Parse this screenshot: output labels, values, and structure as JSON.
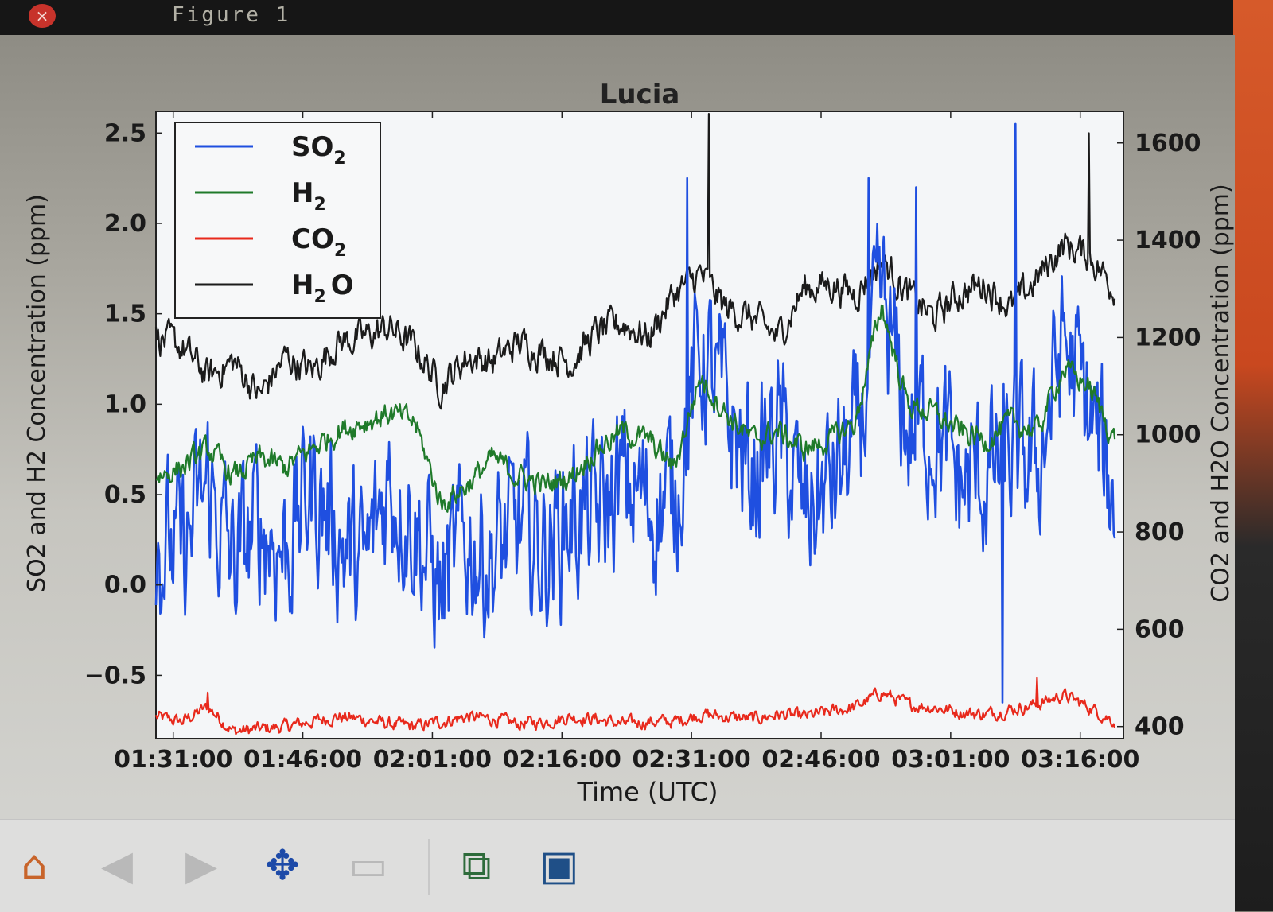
{
  "window": {
    "title": "Figure 1",
    "close_symbol": "×"
  },
  "toolbar": {
    "buttons": [
      {
        "name": "home",
        "icon": "home-icon",
        "glyph": "⌂",
        "enabled": true
      },
      {
        "name": "back",
        "icon": "back-arrow-icon",
        "glyph": "◀",
        "enabled": false
      },
      {
        "name": "forward",
        "icon": "forward-arrow-icon",
        "glyph": "▶",
        "enabled": false
      },
      {
        "name": "pan",
        "icon": "pan-move-icon",
        "glyph": "✥",
        "enabled": true
      },
      {
        "name": "zoom",
        "icon": "zoom-rect-icon",
        "glyph": "▭",
        "enabled": false
      },
      {
        "name": "subplots",
        "icon": "subplots-config-icon",
        "glyph": "⧉",
        "enabled": true
      },
      {
        "name": "save",
        "icon": "save-floppy-icon",
        "glyph": "▣",
        "enabled": true
      }
    ]
  },
  "chart_data": {
    "type": "line",
    "title": "Lucia",
    "xlabel": "Time (UTC)",
    "ylabel_left": "SO2 and H2 Concentration (ppm)",
    "ylabel_right": "CO2 and H2O Concentration (ppm)",
    "x_ticks": [
      "01:31:00",
      "01:46:00",
      "02:01:00",
      "02:16:00",
      "02:31:00",
      "02:46:00",
      "03:01:00",
      "03:16:00"
    ],
    "x_range": [
      "01:29:00",
      "03:21:00"
    ],
    "ylim_left": [
      -0.85,
      2.62
    ],
    "ylim_right": [
      375,
      1665
    ],
    "yticks_left": [
      -0.5,
      0.0,
      0.5,
      1.0,
      1.5,
      2.0,
      2.5
    ],
    "yticks_left_labels": [
      "−0.5",
      "0.0",
      "0.5",
      "1.0",
      "1.5",
      "2.0",
      "2.5"
    ],
    "yticks_right": [
      400,
      600,
      800,
      1000,
      1200,
      1400,
      1600
    ],
    "grid": false,
    "legend_position": "upper-left",
    "series": [
      {
        "name": "SO2",
        "legend_main": "SO",
        "legend_sub": "2",
        "color": "#1f4fe0",
        "axis": "left",
        "times": [
          "01:29",
          "01:32",
          "01:35",
          "01:38",
          "01:41",
          "01:44",
          "01:47",
          "01:50",
          "01:53",
          "01:56",
          "01:59",
          "02:02",
          "02:05",
          "02:08",
          "02:11",
          "02:14",
          "02:17",
          "02:20",
          "02:23",
          "02:26",
          "02:29",
          "02:32",
          "02:35",
          "02:38",
          "02:41",
          "02:44",
          "02:47",
          "02:50",
          "02:53",
          "02:56",
          "02:59",
          "03:02",
          "03:05",
          "03:08",
          "03:11",
          "03:14",
          "03:17",
          "03:20"
        ],
        "values": [
          0.25,
          0.15,
          0.55,
          0.1,
          0.35,
          0.2,
          0.55,
          0.3,
          0.05,
          0.6,
          0.35,
          -0.05,
          0.25,
          0.15,
          0.3,
          0.2,
          0.4,
          0.35,
          0.55,
          0.45,
          0.5,
          1.3,
          0.95,
          0.6,
          0.85,
          0.4,
          0.55,
          0.75,
          1.55,
          0.85,
          0.9,
          0.55,
          0.6,
          0.7,
          0.65,
          1.35,
          0.95,
          0.45
        ]
      },
      {
        "name": "H2",
        "legend_main": "H",
        "legend_sub": "2",
        "color": "#1f7a2a",
        "axis": "left",
        "times": [
          "01:29",
          "01:32",
          "01:35",
          "01:38",
          "01:41",
          "01:44",
          "01:47",
          "01:50",
          "01:53",
          "01:56",
          "01:59",
          "02:02",
          "02:05",
          "02:08",
          "02:11",
          "02:14",
          "02:17",
          "02:20",
          "02:23",
          "02:26",
          "02:29",
          "02:32",
          "02:35",
          "02:38",
          "02:41",
          "02:44",
          "02:47",
          "02:50",
          "02:53",
          "02:56",
          "02:59",
          "03:02",
          "03:05",
          "03:08",
          "03:11",
          "03:14",
          "03:17",
          "03:20"
        ],
        "values": [
          0.6,
          0.65,
          0.75,
          0.6,
          0.7,
          0.65,
          0.75,
          0.85,
          0.9,
          0.95,
          0.9,
          0.45,
          0.55,
          0.7,
          0.6,
          0.55,
          0.6,
          0.75,
          0.85,
          0.8,
          0.65,
          1.15,
          0.95,
          0.8,
          0.85,
          0.75,
          0.8,
          0.9,
          1.55,
          1.0,
          0.95,
          0.85,
          0.8,
          0.9,
          0.85,
          1.2,
          1.1,
          0.8
        ]
      },
      {
        "name": "CO2",
        "legend_main": "CO",
        "legend_sub": "2",
        "color": "#e8291c",
        "axis": "right",
        "times": [
          "01:29",
          "01:32",
          "01:35",
          "01:38",
          "01:41",
          "01:44",
          "01:47",
          "01:50",
          "01:53",
          "01:56",
          "01:59",
          "02:02",
          "02:05",
          "02:08",
          "02:11",
          "02:14",
          "02:17",
          "02:20",
          "02:23",
          "02:26",
          "02:29",
          "02:32",
          "02:35",
          "02:38",
          "02:41",
          "02:44",
          "02:47",
          "02:50",
          "02:53",
          "02:56",
          "02:59",
          "03:02",
          "03:05",
          "03:08",
          "03:11",
          "03:14",
          "03:17",
          "03:20"
        ],
        "values": [
          420,
          410,
          440,
          390,
          395,
          400,
          410,
          420,
          415,
          405,
          400,
          410,
          420,
          415,
          405,
          410,
          420,
          415,
          405,
          410,
          410,
          425,
          420,
          415,
          425,
          420,
          430,
          440,
          470,
          445,
          440,
          430,
          425,
          435,
          445,
          465,
          440,
          410
        ]
      },
      {
        "name": "H2O",
        "legend_main": "H",
        "legend_sub": "2",
        "legend_tail": "O",
        "color": "#1b1b1b",
        "axis": "right",
        "times": [
          "01:29",
          "01:32",
          "01:35",
          "01:38",
          "01:41",
          "01:44",
          "01:47",
          "01:50",
          "01:53",
          "01:56",
          "01:59",
          "02:02",
          "02:05",
          "02:08",
          "02:11",
          "02:14",
          "02:17",
          "02:20",
          "02:23",
          "02:26",
          "02:29",
          "02:32",
          "02:35",
          "02:38",
          "02:41",
          "02:44",
          "02:47",
          "02:50",
          "02:53",
          "02:56",
          "02:59",
          "03:02",
          "03:05",
          "03:08",
          "03:11",
          "03:14",
          "03:17",
          "03:20"
        ],
        "values": [
          1200,
          1180,
          1120,
          1150,
          1080,
          1160,
          1130,
          1190,
          1200,
          1220,
          1180,
          1100,
          1160,
          1150,
          1190,
          1170,
          1150,
          1210,
          1230,
          1200,
          1290,
          1330,
          1260,
          1240,
          1200,
          1300,
          1310,
          1290,
          1360,
          1290,
          1240,
          1290,
          1310,
          1260,
          1320,
          1390,
          1370,
          1300
        ]
      }
    ],
    "spikes": [
      {
        "series": "SO2",
        "time": "02:30:30",
        "value": 2.25
      },
      {
        "series": "SO2",
        "time": "02:51:30",
        "value": 2.25
      },
      {
        "series": "SO2",
        "time": "02:57:00",
        "value": 2.2
      },
      {
        "series": "SO2",
        "time": "03:08:30",
        "value": 2.55
      },
      {
        "series": "SO2",
        "time": "03:07:00",
        "value": -0.65
      },
      {
        "series": "H2O",
        "time": "02:33:00",
        "value": 1660
      },
      {
        "series": "H2O",
        "time": "03:17:00",
        "value": 1620
      },
      {
        "series": "CO2",
        "time": "01:35:00",
        "value": 470
      },
      {
        "series": "CO2",
        "time": "03:11:00",
        "value": 500
      }
    ]
  }
}
